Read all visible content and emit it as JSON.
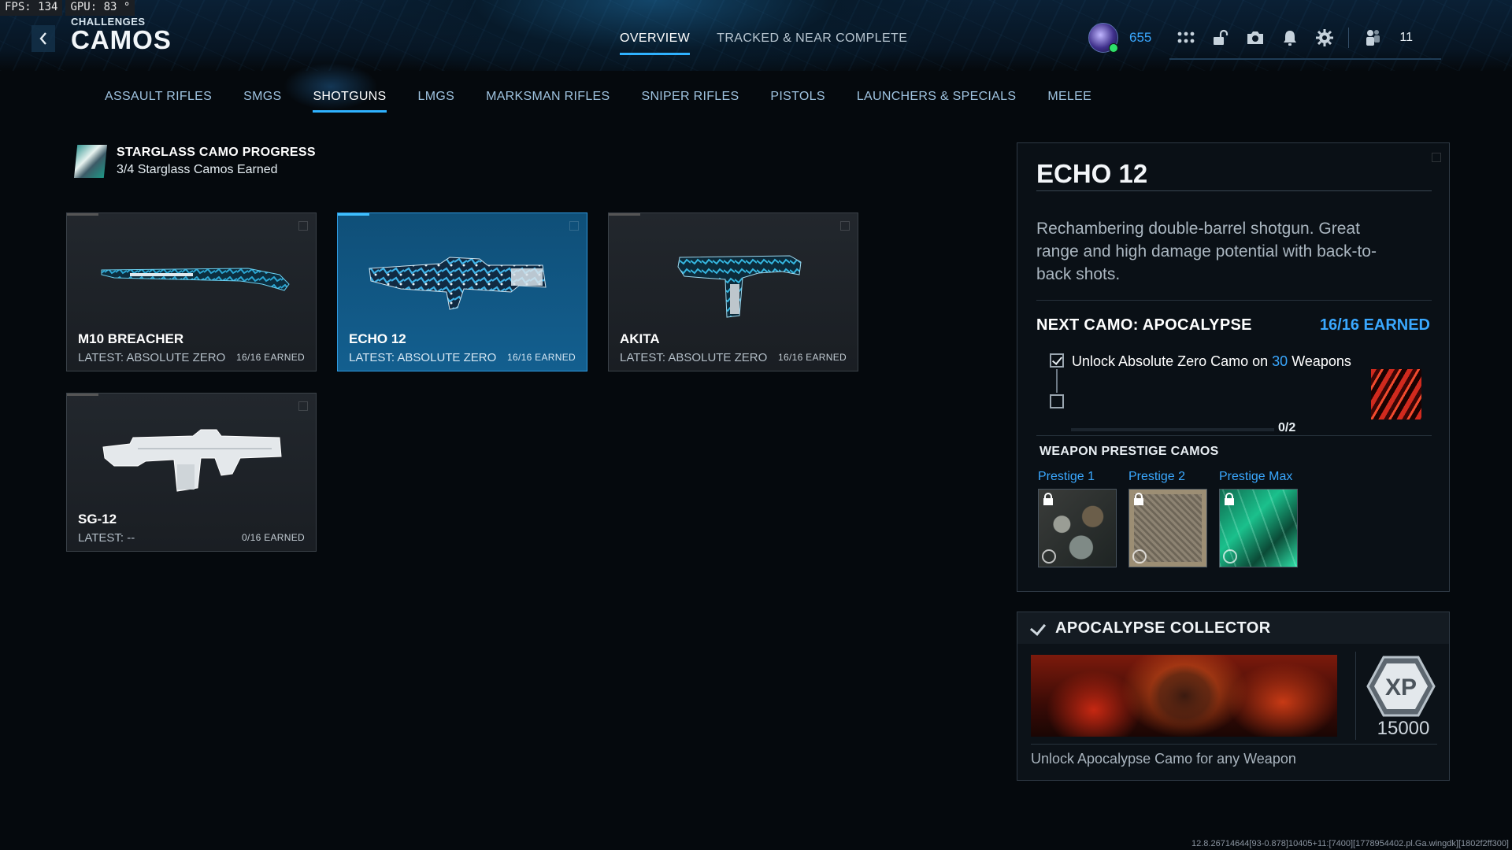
{
  "hud": {
    "fps_label": "FPS: 134",
    "gpu_label": "GPU: 83 °"
  },
  "header": {
    "breadcrumb": "CHALLENGES",
    "title": "CAMOS",
    "tabs": [
      {
        "label": "OVERVIEW",
        "active": true
      },
      {
        "label": "TRACKED & NEAR COMPLETE",
        "active": false
      }
    ],
    "status": {
      "level": "655",
      "friends_count": "11"
    }
  },
  "categories": [
    {
      "label": "ASSAULT RIFLES",
      "active": false
    },
    {
      "label": "SMGS",
      "active": false
    },
    {
      "label": "SHOTGUNS",
      "active": true
    },
    {
      "label": "LMGS",
      "active": false
    },
    {
      "label": "MARKSMAN RIFLES",
      "active": false
    },
    {
      "label": "SNIPER RIFLES",
      "active": false
    },
    {
      "label": "PISTOLS",
      "active": false
    },
    {
      "label": "LAUNCHERS & SPECIALS",
      "active": false
    },
    {
      "label": "MELEE",
      "active": false
    }
  ],
  "progress": {
    "title": "STARGLASS CAMO PROGRESS",
    "subtitle": "3/4 Starglass Camos Earned"
  },
  "weapons": [
    {
      "name": "M10 BREACHER",
      "latest": "LATEST: ABSOLUTE ZERO",
      "earned": "16/16 EARNED",
      "selected": false
    },
    {
      "name": "ECHO 12",
      "latest": "LATEST: ABSOLUTE ZERO",
      "earned": "16/16 EARNED",
      "selected": true
    },
    {
      "name": "AKITA",
      "latest": "LATEST: ABSOLUTE ZERO",
      "earned": "16/16 EARNED",
      "selected": false
    },
    {
      "name": "SG-12",
      "latest": "LATEST: --",
      "earned": "0/16 EARNED",
      "selected": false
    }
  ],
  "detail": {
    "name": "ECHO 12",
    "description": "Rechambering double-barrel shotgun. Great range and high damage potential with back-to-back shots.",
    "next_camo_label": "NEXT CAMO: APOCALYPSE",
    "next_camo_earned": "16/16 EARNED",
    "task_prefix": "Unlock Absolute Zero Camo on",
    "task_number": "30",
    "task_suffix": "Weapons",
    "task_progress": "0/2",
    "task_progress_fraction": 0,
    "prestige_title": "WEAPON PRESTIGE CAMOS",
    "prestige": [
      {
        "label": "Prestige 1",
        "locked": true
      },
      {
        "label": "Prestige 2",
        "locked": true
      },
      {
        "label": "Prestige Max",
        "locked": true
      }
    ]
  },
  "collector": {
    "title": "APOCALYPSE COLLECTOR",
    "xp_badge": "XP",
    "xp_value": "15000",
    "description": "Unlock Apocalypse Camo for any Weapon"
  },
  "build_info": "12.8.26714644[93-0.878]10405+11:[7400][1778954402.pl.Ga.wingdk][1802f2ff300]",
  "colors": {
    "accent_blue": "#3aa8ff",
    "selected_card": "#135f8f",
    "background": "#05090d"
  }
}
